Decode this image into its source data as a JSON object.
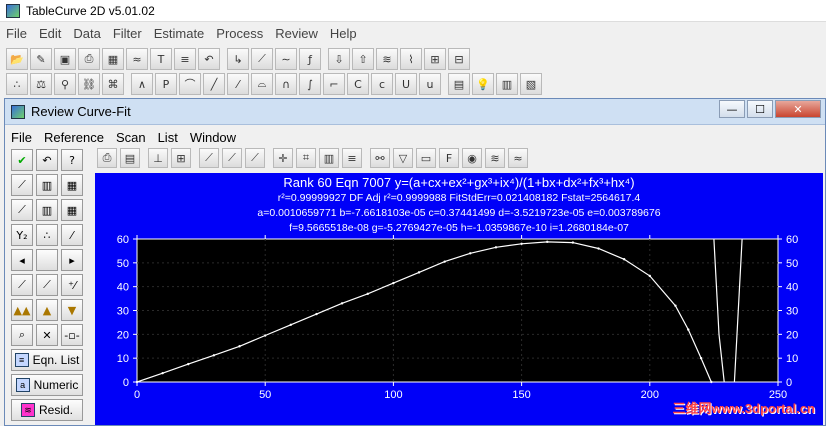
{
  "app": {
    "title": "TableCurve 2D v5.01.02"
  },
  "menu": [
    "File",
    "Edit",
    "Data",
    "Filter",
    "Estimate",
    "Process",
    "Review",
    "Help"
  ],
  "toolbar1": [
    "open-icon",
    "edit-data-icon",
    "save-icon",
    "print-icon",
    "grid-icon",
    "chart-icon",
    "text-icon",
    "undo-icon",
    "arrow-icon",
    "trend-icon",
    "smooth-icon",
    "fx-icon",
    "import-icon",
    "export-icon",
    "transform-icon",
    "filter-icon",
    "rescale-icon",
    "data-icon"
  ],
  "toolbar2": [
    "scatter-icon",
    "weight-icon",
    "pin-icon",
    "link-icon",
    "tangle-icon",
    "peak-icon",
    "pdf-icon",
    "curve1-icon",
    "curve2-icon",
    "line-icon",
    "lognormal-icon",
    "gauss-icon",
    "sigmoid-icon",
    "step-icon",
    "c-icon",
    "c2-icon",
    "u-icon",
    "u2-icon",
    "report-icon",
    "bulb-icon",
    "chart2-icon",
    "list-icon"
  ],
  "child": {
    "title": "Review Curve-Fit",
    "menu": [
      "File",
      "Reference",
      "Scan",
      "List",
      "Window"
    ],
    "win_min": "—",
    "win_max": "☐",
    "win_close": "✕"
  },
  "fit": {
    "line1": "Rank 60  Eqn 7007  y=(a+cx+ex²+gx³+ix⁴)/(1+bx+dx²+fx³+hx⁴)",
    "line2": "r²=0.99999927  DF Adj r²=0.9999988  FitStdErr=0.021408182  Fstat=2564617.4",
    "line3": "a=0.0010659771 b=-7.6618103e-05 c=0.37441499 d=-3.5219723e-05 e=0.003789676",
    "line4": "f=9.5665518e-08 g=-5.2769427e-05 h=-1.0359867e-10 i=1.2680184e-07"
  },
  "left_panel": {
    "eqn_list": "Eqn. List",
    "numeric": "Numeric",
    "resid": "Resid."
  },
  "watermark": "三维网www.3dportal.cn",
  "chart_data": {
    "type": "line",
    "x_ticks": [
      0,
      50,
      100,
      150,
      200,
      250
    ],
    "y_ticks": [
      0,
      10,
      20,
      30,
      40,
      50,
      60
    ],
    "xlim": [
      0,
      250
    ],
    "ylim": [
      0,
      60
    ],
    "background": "#0000f8",
    "plot_area": "#000000",
    "line_color": "#ffffff",
    "curve_main": [
      [
        0,
        0
      ],
      [
        10,
        3.7
      ],
      [
        20,
        7.5
      ],
      [
        30,
        11.2
      ],
      [
        40,
        15
      ],
      [
        50,
        19.5
      ],
      [
        60,
        24
      ],
      [
        70,
        28.5
      ],
      [
        80,
        33
      ],
      [
        90,
        37
      ],
      [
        100,
        41.5
      ],
      [
        110,
        46
      ],
      [
        120,
        50.5
      ],
      [
        130,
        54
      ],
      [
        140,
        56.5
      ],
      [
        150,
        58
      ],
      [
        160,
        58.8
      ],
      [
        170,
        58.5
      ],
      [
        180,
        56
      ],
      [
        190,
        51.5
      ],
      [
        200,
        44.5
      ],
      [
        210,
        32
      ],
      [
        215,
        22
      ],
      [
        220,
        10
      ],
      [
        224,
        0
      ]
    ],
    "curve_branch1": [
      [
        225,
        60
      ],
      [
        227,
        20
      ],
      [
        229,
        0
      ]
    ],
    "curve_branch2": [
      [
        233,
        0
      ],
      [
        234,
        20
      ],
      [
        236,
        60
      ]
    ]
  }
}
